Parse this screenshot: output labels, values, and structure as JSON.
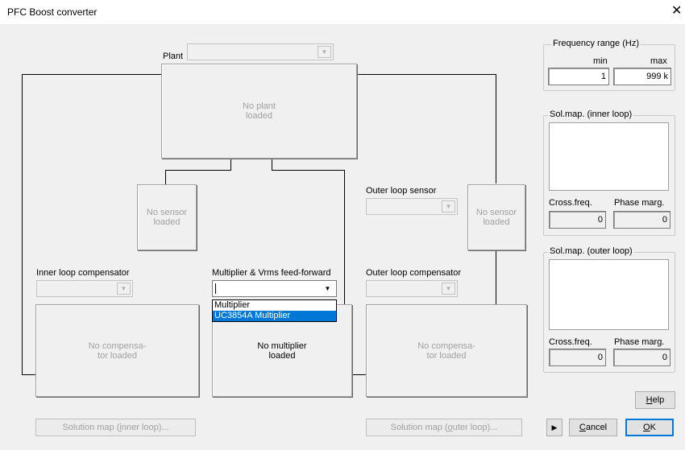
{
  "window": {
    "title": "PFC Boost converter",
    "close_glyph": "✕"
  },
  "plant": {
    "label": "Plant",
    "combo_value": "",
    "block_text": "No plant\nloaded"
  },
  "inner_sensor": {
    "block_text": "No sensor\nloaded"
  },
  "outer_sensor": {
    "label": "Outer loop sensor",
    "combo_value": "",
    "block_text": "No sensor\nloaded"
  },
  "inner_compensator": {
    "label": "Inner loop compensator",
    "combo_value": "",
    "block_text": "No compensa-\ntor loaded"
  },
  "multiplier": {
    "label": "Multiplier & Vrms feed-forward",
    "combo_value": "",
    "options": [
      "Multiplier",
      "UC3854A Multiplier"
    ],
    "selected_index": 1,
    "block_text": "No multiplier\nloaded"
  },
  "outer_compensator": {
    "label": "Outer loop compensator",
    "combo_value": "",
    "block_text": "No compensa-\ntor loaded"
  },
  "frequency_range": {
    "title": "Frequency range (Hz)",
    "min_label": "min",
    "max_label": "max",
    "min_value": "1",
    "max_value": "999 k"
  },
  "sol_map_inner": {
    "title": "Sol.map. (inner loop)",
    "cross_freq_label": "Cross.freq.",
    "phase_marg_label": "Phase marg.",
    "cross_freq_value": "0",
    "phase_marg_value": "0"
  },
  "sol_map_outer": {
    "title": "Sol.map. (outer loop)",
    "cross_freq_label": "Cross.freq.",
    "phase_marg_label": "Phase marg.",
    "cross_freq_value": "0",
    "phase_marg_value": "0"
  },
  "buttons": {
    "solution_map_inner": {
      "pre": "Solution map (",
      "ul": "i",
      "post": "nner loop)..."
    },
    "solution_map_outer": {
      "pre": "Solution map (",
      "ul": "o",
      "post": "uter loop)..."
    },
    "help": {
      "ul": "H",
      "post": "elp"
    },
    "play_glyph": "▶",
    "cancel": {
      "ul": "C",
      "post": "ancel"
    },
    "ok": {
      "ul": "O",
      "post": "K"
    }
  }
}
